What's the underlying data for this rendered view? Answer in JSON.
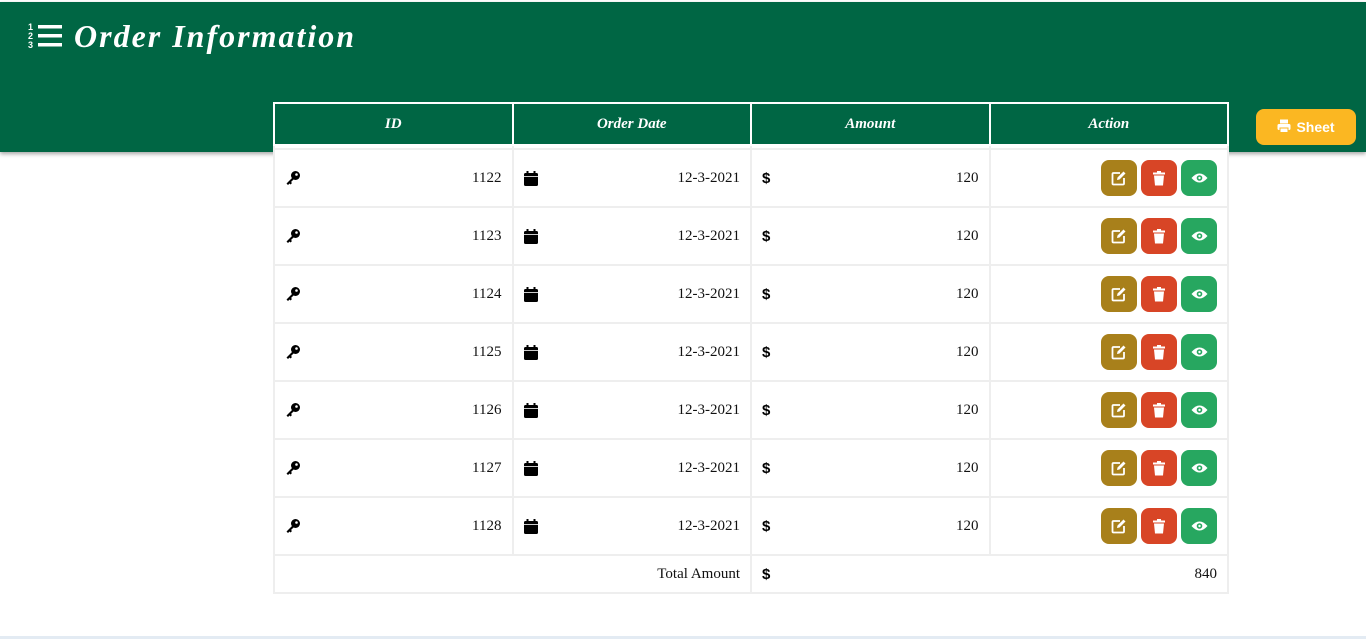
{
  "header": {
    "title": "Order Information",
    "icon": "list-ordered-icon"
  },
  "sheet_button": {
    "label": "Sheet",
    "icon": "print-icon",
    "color": "#fbb722"
  },
  "colors": {
    "header_bg": "#006644",
    "edit": "#a8801b",
    "delete": "#d84526",
    "view": "#27a760"
  },
  "table": {
    "columns": [
      "ID",
      "Order Date",
      "Amount",
      "Action"
    ],
    "rows": [
      {
        "id": "1122",
        "date": "12-3-2021",
        "amount": "120"
      },
      {
        "id": "1123",
        "date": "12-3-2021",
        "amount": "120"
      },
      {
        "id": "1124",
        "date": "12-3-2021",
        "amount": "120"
      },
      {
        "id": "1125",
        "date": "12-3-2021",
        "amount": "120"
      },
      {
        "id": "1126",
        "date": "12-3-2021",
        "amount": "120"
      },
      {
        "id": "1127",
        "date": "12-3-2021",
        "amount": "120"
      },
      {
        "id": "1128",
        "date": "12-3-2021",
        "amount": "120"
      }
    ],
    "total_label": "Total Amount",
    "total_value": "840"
  }
}
